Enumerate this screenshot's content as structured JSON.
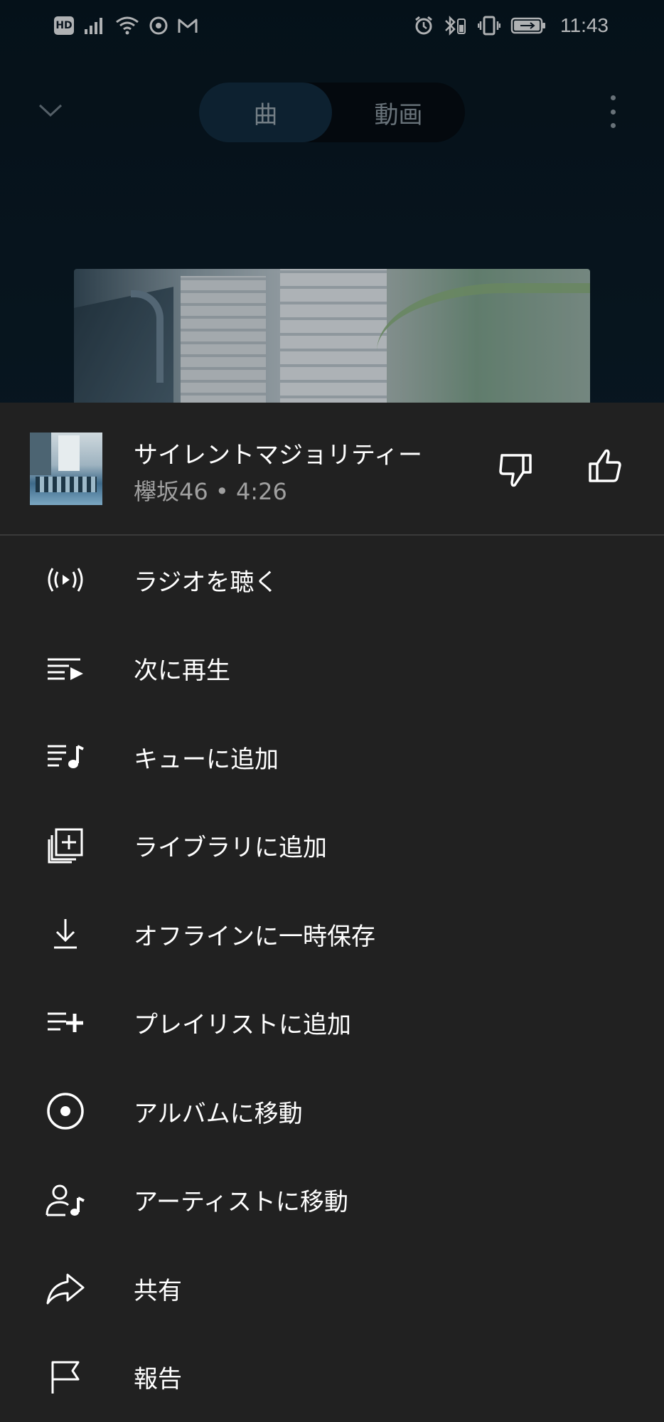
{
  "status_bar": {
    "hd_badge": "HD",
    "time": "11:43",
    "icons": [
      "signal-icon",
      "wifi-icon",
      "record-icon",
      "gmail-icon",
      "alarm-icon",
      "bluetooth-icon",
      "vibrate-icon",
      "battery-icon"
    ]
  },
  "player": {
    "tabs": [
      {
        "label": "曲",
        "active": true
      },
      {
        "label": "動画",
        "active": false
      }
    ]
  },
  "song": {
    "title": "サイレントマジョリティー",
    "subtitle": "欅坂46 • 4:26"
  },
  "menu": {
    "items": [
      {
        "label": "ラジオを聴く",
        "icon": "radio-icon"
      },
      {
        "label": "次に再生",
        "icon": "play-next-icon"
      },
      {
        "label": "キューに追加",
        "icon": "add-to-queue-icon"
      },
      {
        "label": "ライブラリに追加",
        "icon": "library-add-icon"
      },
      {
        "label": "オフラインに一時保存",
        "icon": "download-icon"
      },
      {
        "label": "プレイリストに追加",
        "icon": "playlist-add-icon"
      },
      {
        "label": "アルバムに移動",
        "icon": "album-icon"
      },
      {
        "label": "アーティストに移動",
        "icon": "artist-icon"
      },
      {
        "label": "共有",
        "icon": "share-icon"
      },
      {
        "label": "報告",
        "icon": "flag-icon"
      }
    ]
  },
  "colors": {
    "sheet_bg": "#212121",
    "background": "#0b1620",
    "text": "#ffffff",
    "secondary_text": "#a0a0a0"
  }
}
